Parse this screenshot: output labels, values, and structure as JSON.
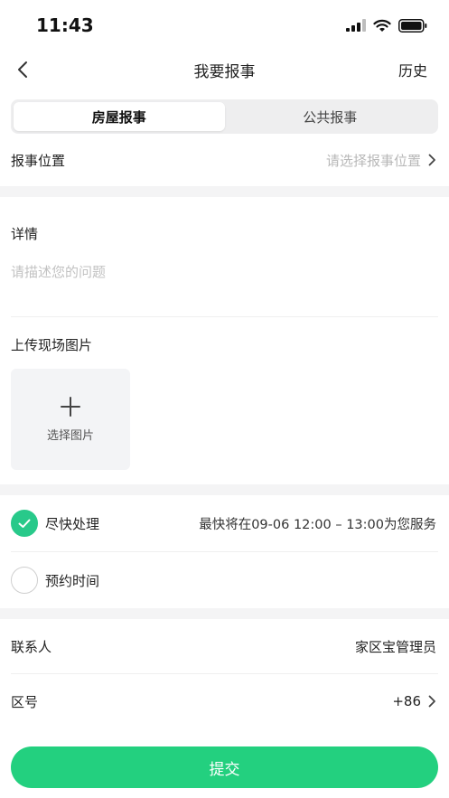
{
  "status_bar": {
    "time": "11:43"
  },
  "nav": {
    "title": "我要报事",
    "right": "历史"
  },
  "tabs": [
    {
      "label": "房屋报事"
    },
    {
      "label": "公共报事"
    }
  ],
  "location": {
    "label": "报事位置",
    "placeholder": "请选择报事位置"
  },
  "details": {
    "label": "详情",
    "placeholder": "请描述您的问题"
  },
  "upload": {
    "label": "上传现场图片",
    "button_label": "选择图片"
  },
  "service": {
    "option_fast": {
      "label": "尽快处理",
      "detail": "最快将在09-06 12:00 – 13:00为您服务"
    },
    "option_schedule": {
      "label": "预约时间"
    }
  },
  "contact": {
    "label": "联系人",
    "value": "家区宝管理员"
  },
  "area_code": {
    "label": "区号",
    "value": "+86"
  },
  "submit": {
    "label": "提交"
  },
  "colors": {
    "accent": "#23d07f",
    "check_bg": "#28c98a"
  }
}
